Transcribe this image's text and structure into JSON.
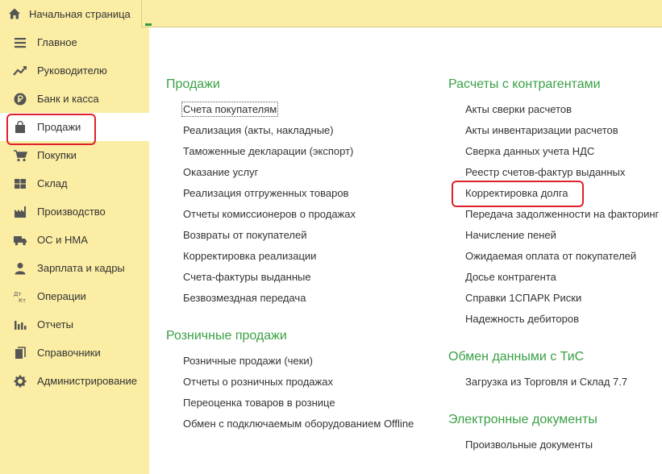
{
  "tabs": {
    "home_label": "Начальная страница"
  },
  "sidebar": {
    "items": [
      {
        "label": "Главное",
        "icon": "menu-lines-icon"
      },
      {
        "label": "Руководителю",
        "icon": "trend-up-icon"
      },
      {
        "label": "Банк и касса",
        "icon": "ruble-coin-icon"
      },
      {
        "label": "Продажи",
        "icon": "shopping-bag-icon"
      },
      {
        "label": "Покупки",
        "icon": "shopping-cart-icon"
      },
      {
        "label": "Склад",
        "icon": "warehouse-grid-icon"
      },
      {
        "label": "Производство",
        "icon": "factory-icon"
      },
      {
        "label": "ОС и НМА",
        "icon": "truck-icon"
      },
      {
        "label": "Зарплата и кадры",
        "icon": "person-icon"
      },
      {
        "label": "Операции",
        "icon": "debit-credit-icon"
      },
      {
        "label": "Отчеты",
        "icon": "bar-chart-icon"
      },
      {
        "label": "Справочники",
        "icon": "books-icon"
      },
      {
        "label": "Администрирование",
        "icon": "gear-icon"
      }
    ],
    "active": "Продажи"
  },
  "sections": {
    "sales": {
      "title": "Продажи",
      "links": [
        "Счета покупателям",
        "Реализация (акты, накладные)",
        "Таможенные декларации (экспорт)",
        "Оказание услуг",
        "Реализация отгруженных товаров",
        "Отчеты комиссионеров о продажах",
        "Возвраты от покупателей",
        "Корректировка реализации",
        "Счета-фактуры выданные",
        "Безвозмездная передача"
      ]
    },
    "retail": {
      "title": "Розничные продажи",
      "links": [
        "Розничные продажи (чеки)",
        "Отчеты о розничных продажах",
        "Переоценка товаров в рознице",
        "Обмен с подключаемым оборудованием Offline"
      ]
    },
    "settlements": {
      "title": "Расчеты с контрагентами",
      "links": [
        "Акты сверки расчетов",
        "Акты инвентаризации расчетов",
        "Сверка данных учета НДС",
        "Реестр счетов-фактур выданных",
        "Корректировка долга",
        "Передача задолженности на факторинг",
        "Начисление пеней",
        "Ожидаемая оплата от покупателей",
        "Досье контрагента",
        "Справки 1СПАРК Риски",
        "Надежность дебиторов"
      ]
    },
    "exchange": {
      "title": "Обмен данными с ТиС",
      "links": [
        "Загрузка из Торговля и Склад 7.7"
      ]
    },
    "edocs": {
      "title": "Электронные документы",
      "links": [
        "Произвольные документы"
      ]
    }
  },
  "colors": {
    "sidebar_bg": "#fbeda3",
    "section_title": "#3aa046",
    "highlight": "#e0202a"
  }
}
